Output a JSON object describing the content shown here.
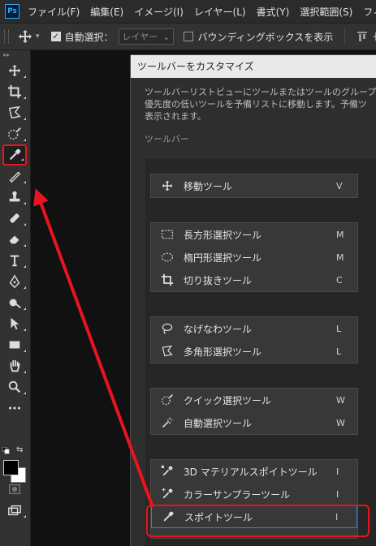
{
  "menubar": {
    "logo": "Ps",
    "items": [
      "ファイル(F)",
      "編集(E)",
      "イメージ(I)",
      "レイヤー(L)",
      "書式(Y)",
      "選択範囲(S)",
      "フィルタ"
    ]
  },
  "options": {
    "auto_select_label": "自動選択：",
    "auto_select_checked": "✓",
    "layer_select": "レイヤー",
    "bounding_box_label": "バウンディングボックスを表示"
  },
  "toolbar": {
    "collapse": "▸▸",
    "tools": [
      "move-icon",
      "crop-icon",
      "lasso-icon",
      "quick-select-icon",
      "eyedropper-icon",
      "brush-icon",
      "stamp-icon",
      "healing-icon",
      "eraser-icon",
      "type-icon",
      "pen-icon",
      "smudge-icon",
      "path-select-icon",
      "rectangle-icon",
      "hand-icon",
      "zoom-icon",
      "more-icon"
    ]
  },
  "dialog": {
    "title": "ツールバーをカスタマイズ",
    "description": [
      "ツールバーリストビューにツールまたはツールのグループを",
      "優先度の低いツールを予備リストに移動します。予備ツ",
      "表示されます。"
    ],
    "section_label": "ツールバー",
    "groups": [
      [
        {
          "name": "移動ツール",
          "key": "V"
        }
      ],
      [
        {
          "name": "長方形選択ツール",
          "key": "M"
        },
        {
          "name": "楕円形選択ツール",
          "key": "M"
        },
        {
          "name": "切り抜きツール",
          "key": "C"
        }
      ],
      [
        {
          "name": "なげなわツール",
          "key": "L"
        },
        {
          "name": "多角形選択ツール",
          "key": "L"
        }
      ],
      [
        {
          "name": "クイック選択ツール",
          "key": "W"
        },
        {
          "name": "自動選択ツール",
          "key": "W"
        }
      ],
      [
        {
          "name": "3D マテリアルスポイトツール",
          "key": "I"
        },
        {
          "name": "カラーサンプラーツール",
          "key": "I"
        },
        {
          "name": "スポイトツール",
          "key": "I"
        }
      ]
    ]
  },
  "colors": {
    "accent_red": "#e8141f",
    "highlight_blue": "#3b7ed8",
    "foreground": "#000000",
    "background": "#ffffff"
  }
}
